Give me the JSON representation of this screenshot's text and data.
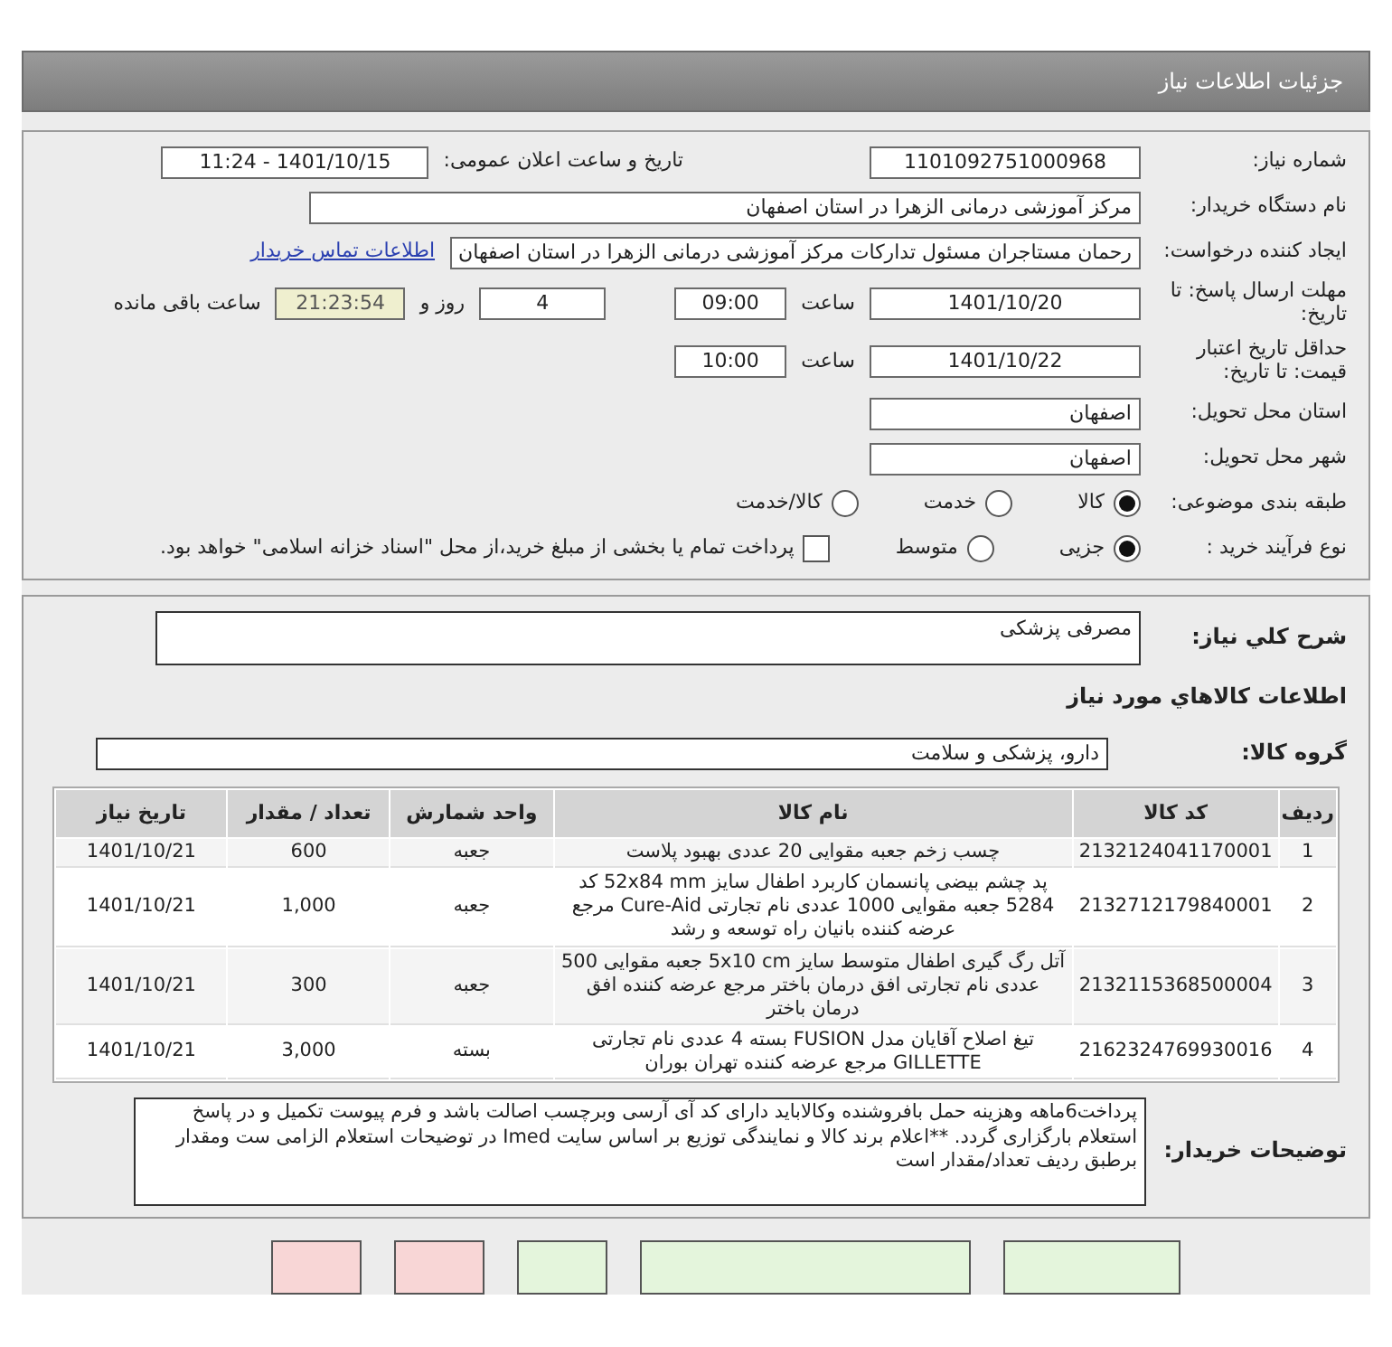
{
  "header": {
    "title": "جزئیات اطلاعات نیاز"
  },
  "details": {
    "need_number": {
      "label": "شماره نیاز:",
      "value": "1101092751000968"
    },
    "announce": {
      "label": "تاریخ و ساعت اعلان عمومی:",
      "value": "1401/10/15 - 11:24"
    },
    "buyer": {
      "label": "نام دستگاه خریدار:",
      "value": "مرکز آموزشی درمانی الزهرا در استان اصفهان"
    },
    "creator": {
      "label": "ایجاد کننده درخواست:",
      "value": "رحمان مستاجران مسئول تدارکات مرکز آموزشی درمانی الزهرا در استان اصفهان",
      "link": "اطلاعات تماس خریدار"
    },
    "deadline": {
      "label": "مهلت ارسال پاسخ: تا تاریخ:",
      "date": "1401/10/20",
      "time_label": "ساعت",
      "time": "09:00",
      "days": "4",
      "days_label": "روز و",
      "remaining": "21:23:54",
      "remaining_label": "ساعت باقی مانده"
    },
    "validity": {
      "label": "حداقل تاریخ اعتبار قیمت: تا تاریخ:",
      "date": "1401/10/22",
      "time_label": "ساعت",
      "time": "10:00"
    },
    "province": {
      "label": "استان محل تحویل:",
      "value": "اصفهان"
    },
    "city": {
      "label": "شهر محل تحویل:",
      "value": "اصفهان"
    },
    "category": {
      "label": "طبقه بندی موضوعی:",
      "options": [
        {
          "label": "کالا",
          "selected": true
        },
        {
          "label": "خدمت",
          "selected": false
        },
        {
          "label": "کالا/خدمت",
          "selected": false
        }
      ]
    },
    "process": {
      "label": "نوع فرآیند خرید :",
      "options": [
        {
          "label": "جزیی",
          "selected": true
        },
        {
          "label": "متوسط",
          "selected": false
        }
      ],
      "treasury": {
        "label": "پرداخت تمام یا بخشی از مبلغ خرید،از محل \"اسناد خزانه اسلامی\" خواهد بود.",
        "checked": false
      }
    }
  },
  "needs": {
    "summary_label": "شرح كلي نياز:",
    "summary": "مصرفی پزشکی",
    "goods_heading": "اطلاعات كالاهاي مورد نياز",
    "group_label": "گروه کالا:",
    "group": "دارو، پزشکی و سلامت",
    "table": {
      "columns": [
        "ردیف",
        "کد کالا",
        "نام کالا",
        "واحد شمارش",
        "تعداد / مقدار",
        "تاریخ نیاز"
      ],
      "rows": [
        [
          "1",
          "2132124041170001",
          "چسب زخم جعبه مقوایی 20 عددی بهبود پلاست",
          "جعبه",
          "600",
          "1401/10/21"
        ],
        [
          "2",
          "2132712179840001",
          "پد چشم بیضی پانسمان کاربرد اطفال سایز 52x84 mm کد 5284 جعبه مقوایی 1000 عددی نام تجارتی Cure-Aid مرجع عرضه کننده بانیان راه توسعه و رشد",
          "جعبه",
          "1,000",
          "1401/10/21"
        ],
        [
          "3",
          "2132115368500004",
          "آتل رگ گیری اطفال متوسط سایز 5x10 cm جعبه مقوایی 500 عددی نام تجارتی افق درمان باختر مرجع عرضه کننده افق درمان باختر",
          "جعبه",
          "300",
          "1401/10/21"
        ],
        [
          "4",
          "2162324769930016",
          "تیغ اصلاح آقایان مدل FUSION بسته 4 عددی نام تجارتی GILLETTE مرجع عرضه کننده تهران بوران",
          "بسته",
          "3,000",
          "1401/10/21"
        ]
      ]
    },
    "notes_label": "توضیحات خریدار:",
    "notes": "پرداخت6ماهه وهزینه حمل بافروشنده وکالاباید دارای کد آی آرسی وبرچسب اصالت باشد و فرم پیوست تکمیل و در پاسخ استعلام بارگزاری گردد. **اعلام برند کالا و نمایندگی توزیع بر اساس سایت Imed در توضیحات استعلام الزامی ست ومقدار برطبق ردیف تعداد/مقدار است"
  },
  "bottom_buttons": [
    {
      "color": "#e4f5dc"
    },
    {
      "color": "#e4f5dc"
    },
    {
      "color": "#e4f5dc"
    },
    {
      "color": "#f8d6d6"
    },
    {
      "color": "#f8d6d6"
    }
  ]
}
